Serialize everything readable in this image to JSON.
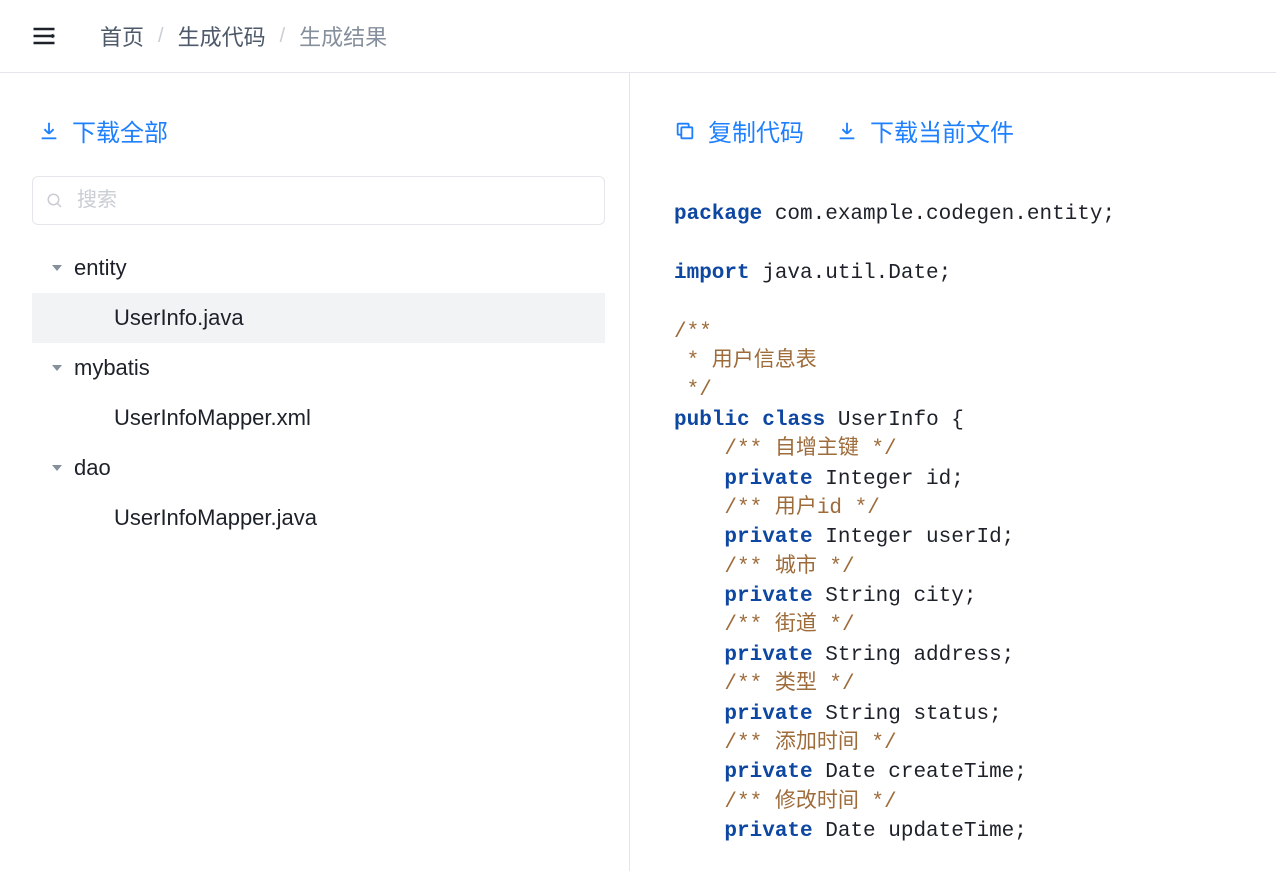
{
  "breadcrumb": {
    "items": [
      "首页",
      "生成代码",
      "生成结果"
    ]
  },
  "left": {
    "download_all": "下载全部",
    "search_placeholder": "搜索",
    "tree": [
      {
        "type": "folder",
        "label": "entity"
      },
      {
        "type": "file",
        "label": "UserInfo.java",
        "selected": true
      },
      {
        "type": "folder",
        "label": "mybatis"
      },
      {
        "type": "file",
        "label": "UserInfoMapper.xml"
      },
      {
        "type": "folder",
        "label": "dao"
      },
      {
        "type": "file",
        "label": "UserInfoMapper.java"
      }
    ]
  },
  "right": {
    "copy_code": "复制代码",
    "download_current": "下载当前文件"
  },
  "code": {
    "kw_package": "package",
    "pkg": " com.example.codegen.entity;",
    "kw_import": "import",
    "imp": " java.util.Date;",
    "cm_top1": "/**",
    "cm_top2": " * 用户信息表",
    "cm_top3": " */",
    "kw_public": "public",
    "kw_class": "class",
    "class_decl": " UserInfo {",
    "f1_cm": "    /** 自增主键 */",
    "kw_private": "private",
    "f1_type": " Integer id;",
    "f2_cm": "    /** 用户id */",
    "f2_type": " Integer userId;",
    "f3_cm": "    /** 城市 */",
    "f3_type": " String city;",
    "f4_cm": "    /** 街道 */",
    "f4_type": " String address;",
    "f5_cm": "    /** 类型 */",
    "f5_type": " String status;",
    "f6_cm": "    /** 添加时间 */",
    "f6_type": " Date createTime;",
    "f7_cm": "    /** 修改时间 */",
    "f7_type": " Date updateTime;",
    "indent": "    "
  }
}
